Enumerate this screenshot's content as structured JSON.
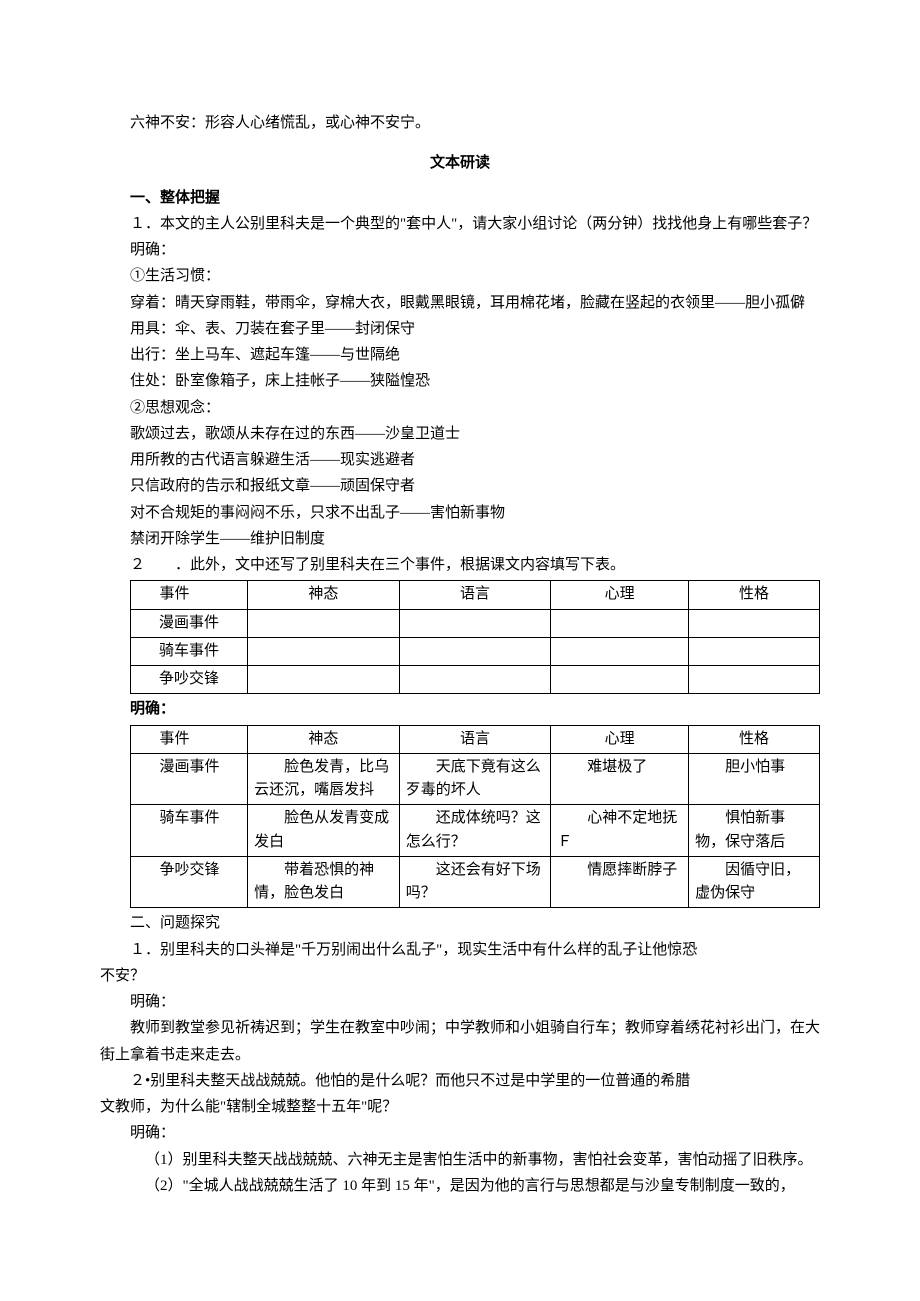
{
  "intro": "六神不安：形容人心绪慌乱，或心神不安宁。",
  "heading": "文本研读",
  "sec1": {
    "title": "一、整体把握",
    "q1": "１．本文的主人公别里科夫是一个典型的\"套中人\"，请大家小组讨论（两分钟）找找他身上有哪些套子？",
    "mingque": "明确：",
    "habit_label": "①生活习惯：",
    "habit1": "穿着：晴天穿雨鞋，带雨伞，穿棉大衣，眼戴黑眼镜，耳用棉花堵，脸藏在竖起的衣领里——胆小孤僻",
    "habit2": "用具：伞、表、刀装在套子里——封闭保守",
    "habit3": "出行：坐上马车、遮起车篷——与世隔绝",
    "habit4": "住处：卧室像箱子，床上挂帐子——狭隘惶恐",
    "idea_label": "②思想观念：",
    "idea1": "歌颂过去，歌颂从未存在过的东西——沙皇卫道士",
    "idea2": "用所教的古代语言躲避生活——现实逃避者",
    "idea3": "只信政府的告示和报纸文章——顽固保守者",
    "idea4": "对不合规矩的事闷闷不乐，只求不出乱子——害怕新事物",
    "idea5": "禁闭开除学生——维护旧制度",
    "q2": "２　　．此外，文中还写了别里科夫在三个事件，根据课文内容填写下表。"
  },
  "table1": {
    "h1": "事件",
    "h2": "神态",
    "h3": "语言",
    "h4": "心理",
    "h5": "性格",
    "r1": "漫画事件",
    "r2": "骑车事件",
    "r3": "争吵交锋"
  },
  "mingque2": "明确：",
  "table2": {
    "h1": "事件",
    "h2": "神态",
    "h3": "语言",
    "h4": "心理",
    "h5": "性格",
    "row1": {
      "c1": "漫画事件",
      "c2": "　　脸色发青，比乌云还沉，嘴唇发抖",
      "c3": "　　天底下竟有这么歹毒的坏人",
      "c4": "　　难堪极了",
      "c5": "　　胆小怕事"
    },
    "row2": {
      "c1": "骑车事件",
      "c2": "　　脸色从发青变成发白",
      "c3": "　　还成体统吗？这怎么行？",
      "c4": "　　心神不定地抚Ｆ",
      "c5": "　　惧怕新事物，保守落后"
    },
    "row3": {
      "c1": "争吵交锋",
      "c2": "　　带着恐惧的神情，脸色发白",
      "c3": "　　这还会有好下场吗？",
      "c4": "　　情愿摔断脖子",
      "c5": "　　因循守旧，虚伪保守"
    }
  },
  "sec2": {
    "title": "二、问题探究",
    "q1a": "１．别里科夫的口头禅是\"千万别闹出什么乱子\"，现实生活中有什么样的乱子让他惊恐",
    "q1b": "不安？",
    "mingque": "明确：",
    "a1": "教师到教堂参见祈祷迟到；学生在教室中吵闹；中学教师和小姐骑自行车；教师穿着绣花衬衫出门，在大街上拿着书走来走去。",
    "q2a": "２•别里科夫整天战战兢兢。他怕的是什么呢？而他只不过是中学里的一位普通的希腊",
    "q2b": "文教师，为什么能\"辖制全城整整十五年\"呢？",
    "mingque2": "明确：",
    "a2_1": "（1）别里科夫整天战战兢兢、六神无主是害怕生活中的新事物，害怕社会变革，害怕动摇了旧秩序。",
    "a2_2": "（2）\"全城人战战兢兢生活了 10 年到 15 年\"，是因为他的言行与思想都是与沙皇专制制度一致的，"
  }
}
